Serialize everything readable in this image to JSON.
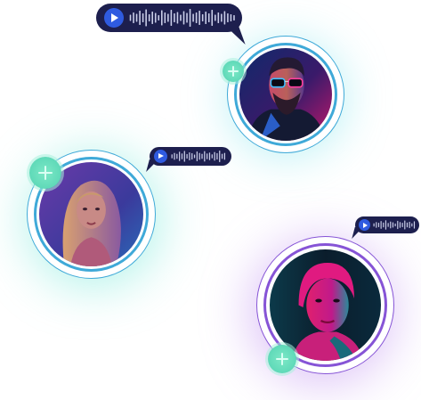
{
  "colors": {
    "bubble_bg": "#1d1f4e",
    "play_button": "#2f5be0",
    "waveform": "#c9cde8",
    "ring_teal": "#3fa9d8",
    "ring_purple": "#8654d6",
    "plus_badge": "#5fd9b8"
  },
  "voice_messages": [
    {
      "id": "voice-message-1",
      "icon": "play-icon"
    },
    {
      "id": "voice-message-2",
      "icon": "play-icon"
    },
    {
      "id": "voice-message-3",
      "icon": "play-icon"
    }
  ],
  "avatars": [
    {
      "id": "avatar-man-sunglasses",
      "ring": "teal",
      "badge": "add-icon"
    },
    {
      "id": "avatar-woman-long-hair",
      "ring": "teal",
      "badge": "add-icon"
    },
    {
      "id": "avatar-woman-pink-light",
      "ring": "purple",
      "badge": "add-icon"
    }
  ]
}
